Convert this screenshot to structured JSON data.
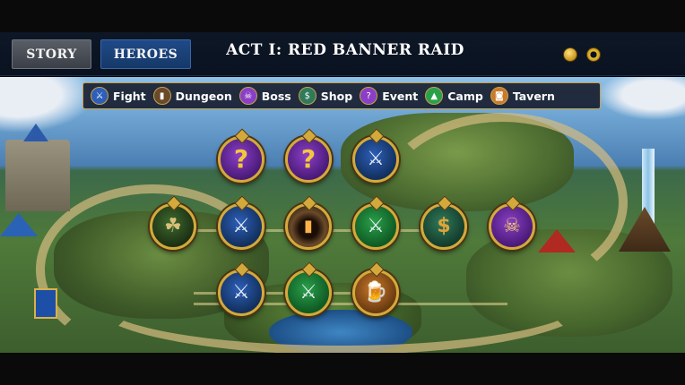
{
  "header": {
    "tabs": [
      {
        "label": "STORY",
        "active": false
      },
      {
        "label": "HEROES",
        "active": true
      }
    ],
    "title": "ACT I: RED BANNER RAID",
    "currency_icons": [
      "gold-coin-icon",
      "gold-ring-icon"
    ]
  },
  "legend": {
    "items": [
      {
        "label": "Fight",
        "icon": "crossed-swords-icon",
        "color": "#2d5fb8"
      },
      {
        "label": "Dungeon",
        "icon": "dungeon-gate-icon",
        "color": "#6a4a2a"
      },
      {
        "label": "Boss",
        "icon": "skull-crown-icon",
        "color": "#8a3fc6"
      },
      {
        "label": "Shop",
        "icon": "money-bag-icon",
        "color": "#2f7a5a"
      },
      {
        "label": "Event",
        "icon": "question-mark-icon",
        "color": "#8a3fc6"
      },
      {
        "label": "Camp",
        "icon": "campfire-icon",
        "color": "#2aa04a"
      },
      {
        "label": "Tavern",
        "icon": "ale-mug-icon",
        "color": "#c97a2a"
      }
    ]
  },
  "map": {
    "nodes": [
      {
        "type": "event",
        "icon": "question-mark-icon",
        "glyph": "?"
      },
      {
        "type": "event",
        "icon": "question-mark-icon",
        "glyph": "?"
      },
      {
        "type": "fight",
        "icon": "crossed-swords-icon",
        "glyph": "⚔"
      },
      {
        "type": "start",
        "icon": "hero-portrait-icon",
        "glyph": "☘"
      },
      {
        "type": "fight",
        "icon": "crossed-swords-icon",
        "glyph": "⚔"
      },
      {
        "type": "dungeon",
        "icon": "dungeon-gate-icon",
        "glyph": "▮"
      },
      {
        "type": "camp",
        "icon": "crossed-swords-icon",
        "glyph": "⚔"
      },
      {
        "type": "shop",
        "icon": "money-bag-icon",
        "glyph": "$"
      },
      {
        "type": "boss",
        "icon": "skull-crown-icon",
        "glyph": "☠"
      },
      {
        "type": "fight",
        "icon": "crossed-swords-icon",
        "glyph": "⚔"
      },
      {
        "type": "camp",
        "icon": "crossed-swords-icon",
        "glyph": "⚔"
      },
      {
        "type": "tavern",
        "icon": "ale-mug-icon",
        "glyph": "🍺"
      }
    ]
  }
}
